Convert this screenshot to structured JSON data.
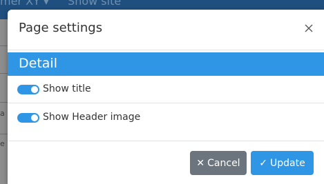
{
  "background": {
    "topbar_text": "mer XY ▾",
    "topbar_link": "Show site",
    "edge_labels": [
      "a",
      "e"
    ]
  },
  "modal": {
    "title": "Page settings",
    "close_icon": "close-icon",
    "section_title": "Detail",
    "options": [
      {
        "label": "Show title",
        "enabled": true
      },
      {
        "label": "Show Header image",
        "enabled": true
      }
    ],
    "buttons": {
      "cancel_label": "Cancel",
      "cancel_icon": "✕",
      "update_label": "Update",
      "update_icon": "✓"
    }
  },
  "colors": {
    "accent": "#2f96e6",
    "cancel": "#6c757d",
    "header_bar": "#1f4f7f"
  }
}
